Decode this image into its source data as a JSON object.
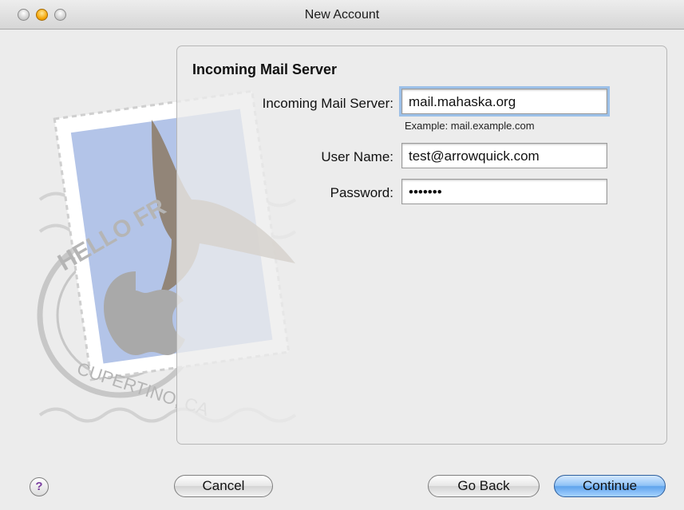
{
  "window": {
    "title": "New Account"
  },
  "artwork": {
    "top_text": "HELLO FR",
    "bottom_text": "CUPERTINO, CA"
  },
  "panel": {
    "heading": "Incoming Mail Server"
  },
  "form": {
    "server": {
      "label": "Incoming Mail Server:",
      "value": "mail.mahaska.org",
      "hint": "Example: mail.example.com"
    },
    "username": {
      "label": "User Name:",
      "value": "test@arrowquick.com"
    },
    "password": {
      "label": "Password:",
      "value": "•••••••"
    }
  },
  "buttons": {
    "help": "?",
    "cancel": "Cancel",
    "back": "Go Back",
    "continue": "Continue"
  },
  "colors": {
    "focus_ring": "#9cc0e8",
    "primary_button": "#5fa3ec",
    "help_glyph": "#7a3fa0"
  }
}
